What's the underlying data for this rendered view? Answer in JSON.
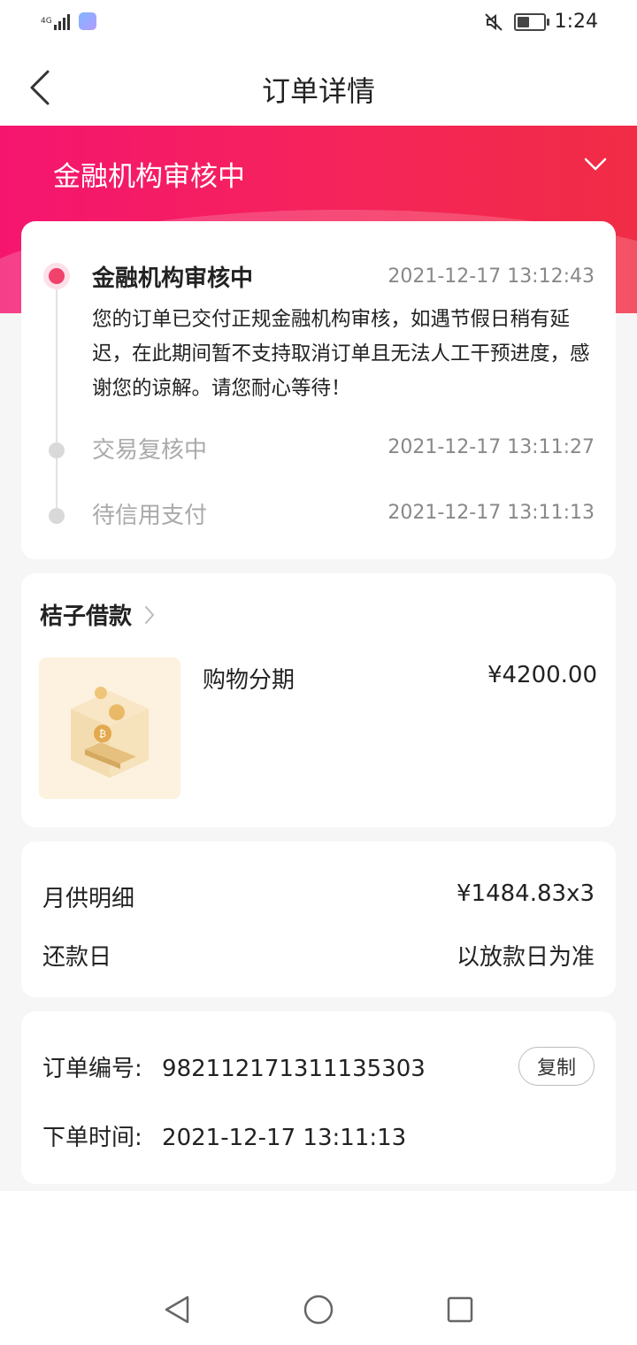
{
  "status_bar": {
    "network": "4G",
    "time": "1:24",
    "battery_level": 0.45
  },
  "nav": {
    "title": "订单详情"
  },
  "banner": {
    "status": "金融机构审核中"
  },
  "timeline": [
    {
      "title": "金融机构审核中",
      "time": "2021-12-17 13:12:43",
      "active": true,
      "description": "您的订单已交付正规金融机构审核，如遇节假日稍有延迟，在此期间暂不支持取消订单且无法人工干预进度，感谢您的谅解。请您耐心等待！"
    },
    {
      "title": "交易复核中",
      "time": "2021-12-17 13:11:27",
      "active": false
    },
    {
      "title": "待信用支付",
      "time": "2021-12-17 13:11:13",
      "active": false
    }
  ],
  "product": {
    "provider": "桔子借款",
    "name": "购物分期",
    "price": "¥4200.00"
  },
  "repayment": [
    {
      "label": "月供明细",
      "value": "¥1484.83x3"
    },
    {
      "label": "还款日",
      "value": "以放款日为准"
    }
  ],
  "order": {
    "number_label": "订单编号:",
    "number": "982112171311135303",
    "copy_label": "复制",
    "time_label": "下单时间:",
    "time": "2021-12-17 13:11:13"
  },
  "colors": {
    "accent": "#f5245a",
    "active_dot": "#f0426b"
  }
}
